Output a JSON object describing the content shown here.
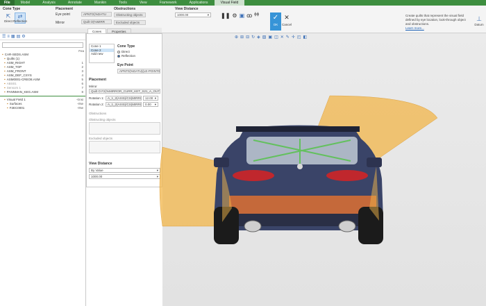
{
  "menu": {
    "file": "File",
    "items": [
      "Model",
      "Analysis",
      "Annotate",
      "Manikin",
      "Tools",
      "View",
      "Framework",
      "Applications",
      "Visual Field"
    ],
    "active_index": 8
  },
  "ribbon": {
    "cone_type": {
      "title": "Cone Type",
      "direct": "Direct",
      "reflection": "Reflection"
    },
    "placement": {
      "title": "Placement",
      "eye_point": "Eye point",
      "mirror": "Mirror",
      "eye_point_value": "APNTO(%DATU",
      "mirror_value": "Quilt O(%MIRR"
    },
    "obstructions": {
      "title": "Obstructions",
      "obstructing": "Obstructing objects",
      "excluded": "Excluded objects"
    },
    "view_distance": {
      "title": "View Distance",
      "value": "1000.00"
    },
    "ok": "OK",
    "cancel": "Cancel",
    "tooltip_text": "Create quilts that represent the visual field defined by eye location, look-through object and obstructions.",
    "tooltip_link": "Learn more...",
    "datum": "Datum"
  },
  "subtabs": [
    "Cones",
    "Properties"
  ],
  "tree": {
    "col_header": "Fea",
    "items": [
      {
        "label": "CAR-SEDS.ASM",
        "num": "",
        "gray": false
      },
      {
        "label": "Quilts (1)",
        "num": "",
        "gray": false
      },
      {
        "label": "ASM_RIGHT",
        "num": "1",
        "gray": false
      },
      {
        "label": "ASM_TOP",
        "num": "2",
        "gray": false
      },
      {
        "label": "ASM_FRONT",
        "num": "3",
        "gray": false
      },
      {
        "label": "ASM_DEF_CSYS",
        "num": "4",
        "gray": false
      },
      {
        "label": "ASM0001-CREO8.ASM",
        "num": "5",
        "gray": false
      },
      {
        "label": "ABS01",
        "num": "6",
        "gray": true
      },
      {
        "label": "Sensors 1",
        "num": "7",
        "gray": true
      },
      {
        "label": "PANNMAN_KEG.ASM",
        "num": "8",
        "gray": false
      },
      {
        "label": "Visual Field 1",
        "num": "<Insi",
        "gray": false
      },
      {
        "label": "Surfaces",
        "num": "<Ne",
        "gray": false
      },
      {
        "label": "F2EC0001",
        "num": "<Ne",
        "gray": false
      }
    ]
  },
  "panel": {
    "cones": [
      "Cone 1",
      "Cone 2",
      "Add new"
    ],
    "selected_cone": 1,
    "cone_type_title": "Cone Type",
    "direct": "Direct",
    "reflection": "Reflection",
    "eye_point_title": "Eye Point",
    "eye_point_value": "APNT0(%DATU)(LE-POINT0:CI",
    "placement_title": "Placement",
    "mirror_label": "Mirror",
    "mirror_value": "Quilt O F2(%MIRROR_CURR_KET_S21_A_OUT_TRE",
    "rotation1_label": "Rotation 1:",
    "rotation1_value": "A_1_2(AXIS)/CS(MIRRO",
    "rotation1_num": "12.00",
    "rotation2_label": "Rotation 2:",
    "rotation2_value": "A_1_2(AXIS)/CS(MIRRO",
    "rotation2_num": "0.00",
    "obstructions_title": "Obstructions",
    "obstructing_label": "Obstructing objects",
    "excluded_label": "Excluded objects",
    "view_distance_title": "View Distance",
    "vd_mode": "By Value",
    "vd_value": "1000.00"
  },
  "colors": {
    "menubar": "#3d8e3f",
    "accent": "#3794d7",
    "cone": "#f1b64a"
  }
}
